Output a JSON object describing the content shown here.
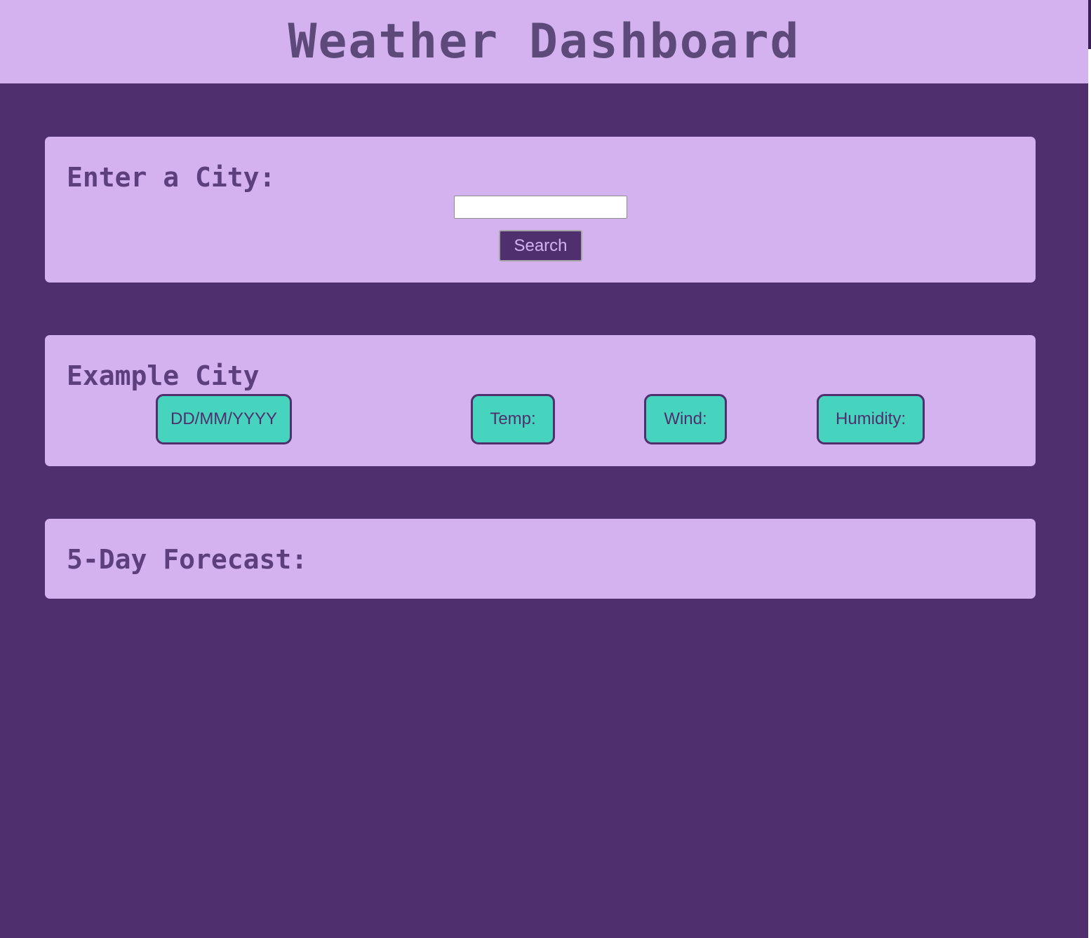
{
  "header": {
    "title": "Weather Dashboard"
  },
  "search": {
    "label": "Enter a City:",
    "input_value": "",
    "placeholder": "",
    "button_label": "Search"
  },
  "current": {
    "city": "Example City",
    "date": "DD/MM/YYYY",
    "temp_label": "Temp:",
    "wind_label": "Wind:",
    "humidity_label": "Humidity:"
  },
  "forecast": {
    "title": "5-Day Forecast:"
  },
  "colors": {
    "background": "#4f2f6d",
    "panel": "#d4b2f0",
    "accent": "#47d4bf",
    "heading_text": "#5d4a7a"
  }
}
